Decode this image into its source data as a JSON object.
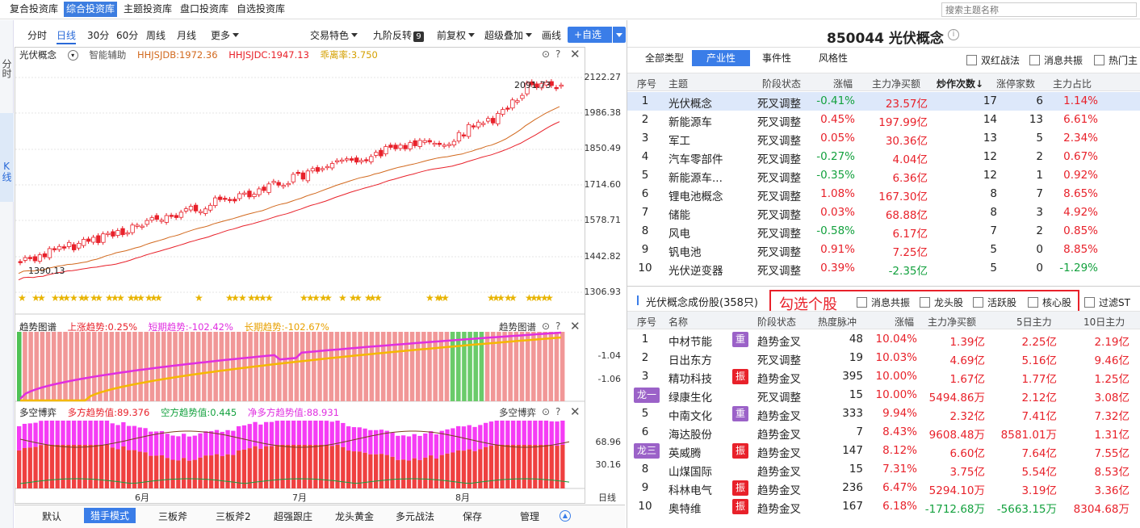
{
  "top_tabs": [
    "复合投资库",
    "综合投资库",
    "主题投资库",
    "盘口投资库",
    "自选投资库"
  ],
  "search_placeholder": "搜索主题名称",
  "side": {
    "fenshi": "分时",
    "kline": "K线"
  },
  "periods": [
    "分时",
    "日线",
    "30分",
    "60分",
    "周线",
    "月线",
    "更多"
  ],
  "tools": {
    "jiaoyi": "交易特色",
    "jiujie": "九阶反转",
    "jiujie_badge": "9",
    "fuquan": "前复权",
    "chaoji": "超级叠加",
    "huaxian": "画线",
    "add": "+自选"
  },
  "main_head": {
    "name": "光伏概念",
    "assist": "智能辅助",
    "hhjsjdb": "HHJSJDB:1972.36",
    "hhjsjdc": "HHJSJDC:1947.13",
    "pianli": "乖离率:3.750"
  },
  "price_axis": [
    "2122.27",
    "1986.38",
    "1850.49",
    "1714.60",
    "1578.71",
    "1442.82",
    "1306.93"
  ],
  "price_high": "2091.73",
  "price_low": "1390.13",
  "trend_head": {
    "title": "趋势图谱",
    "up": "上涨趋势:0.25%",
    "short": "短期趋势:-102.42%",
    "long": "长期趋势:-102.67%",
    "right": "趋势图谱"
  },
  "trend_axis": [
    "-1.04",
    "-1.06"
  ],
  "game_head": {
    "title": "多空博弈",
    "long": "多方趋势值:89.376",
    "short": "空方趋势值:0.445",
    "net": "净多方趋势值:88.931",
    "right": "多空博弈"
  },
  "game_axis": [
    "68.96",
    "30.16"
  ],
  "months": [
    "6月",
    "7月",
    "8月"
  ],
  "period_label": "日线",
  "bottom_tabs": [
    "默认",
    "猎手模式",
    "三板斧",
    "三板斧2",
    "超强跟庄",
    "龙头黄金",
    "多元战法",
    "保存",
    "管理"
  ],
  "code_title": "850044 光伏概念",
  "type_tabs": [
    "全部类型",
    "产业性",
    "事件性",
    "风格性"
  ],
  "top_checks": [
    "双红战法",
    "消息共振",
    "热门主"
  ],
  "theme_headers": [
    "序号",
    "主题",
    "阶段状态",
    "涨幅",
    "主力净买额",
    "炒作次数",
    "涨停家数",
    "主力占比"
  ],
  "themes": [
    {
      "no": "1",
      "name": "光伏概念",
      "stage": "死叉调整",
      "chg": "-0.41%",
      "net": "23.57亿",
      "times": "17",
      "limit": "6",
      "ratio": "1.14%"
    },
    {
      "no": "2",
      "name": "新能源车",
      "stage": "死叉调整",
      "chg": "0.45%",
      "net": "197.99亿",
      "times": "14",
      "limit": "13",
      "ratio": "6.61%"
    },
    {
      "no": "3",
      "name": "军工",
      "stage": "死叉调整",
      "chg": "0.05%",
      "net": "30.36亿",
      "times": "13",
      "limit": "5",
      "ratio": "2.34%"
    },
    {
      "no": "4",
      "name": "汽车零部件",
      "stage": "死叉调整",
      "chg": "-0.27%",
      "net": "4.04亿",
      "times": "12",
      "limit": "2",
      "ratio": "0.67%"
    },
    {
      "no": "5",
      "name": "新能源车...",
      "stage": "死叉调整",
      "chg": "-0.35%",
      "net": "6.36亿",
      "times": "12",
      "limit": "1",
      "ratio": "0.92%"
    },
    {
      "no": "6",
      "name": "锂电池概念",
      "stage": "死叉调整",
      "chg": "1.08%",
      "net": "167.30亿",
      "times": "8",
      "limit": "7",
      "ratio": "8.65%"
    },
    {
      "no": "7",
      "name": "储能",
      "stage": "死叉调整",
      "chg": "0.03%",
      "net": "68.88亿",
      "times": "8",
      "limit": "3",
      "ratio": "4.92%"
    },
    {
      "no": "8",
      "name": "风电",
      "stage": "死叉调整",
      "chg": "-0.58%",
      "net": "6.17亿",
      "times": "7",
      "limit": "2",
      "ratio": "0.85%"
    },
    {
      "no": "9",
      "name": "钒电池",
      "stage": "死叉调整",
      "chg": "0.91%",
      "net": "7.25亿",
      "times": "5",
      "limit": "0",
      "ratio": "8.85%"
    },
    {
      "no": "10",
      "name": "光伏逆变器",
      "stage": "死叉调整",
      "chg": "0.39%",
      "net": "-2.35亿",
      "times": "5",
      "limit": "0",
      "ratio": "-1.29%"
    }
  ],
  "comp_title": "光伏概念成份股(358只)",
  "gouxuan": "勾选个股",
  "comp_checks": [
    "消息共振",
    "龙头股",
    "活跃股",
    "核心股"
  ],
  "filter_st": "过滤ST",
  "stock_headers": [
    "序号",
    "名称",
    "阶段状态",
    "热度脉冲",
    "涨幅",
    "主力净买额",
    "5日主力",
    "10日主力"
  ],
  "stocks": [
    {
      "no": "1",
      "name": "中材节能",
      "tag": "重",
      "stage": "趋势金叉",
      "heat": "48",
      "chg": "10.04%",
      "net": "1.39亿",
      "d5": "2.25亿",
      "d10": "2.19亿"
    },
    {
      "no": "2",
      "name": "日出东方",
      "tag": "",
      "stage": "死叉调整",
      "heat": "19",
      "chg": "10.03%",
      "net": "4.69亿",
      "d5": "5.16亿",
      "d10": "9.46亿"
    },
    {
      "no": "3",
      "name": "精功科技",
      "tag": "振",
      "stage": "趋势金叉",
      "heat": "395",
      "chg": "10.00%",
      "net": "1.67亿",
      "d5": "1.77亿",
      "d10": "1.25亿"
    },
    {
      "no": "龙一",
      "name": "绿康生化",
      "tag": "",
      "stage": "死叉调整",
      "heat": "15",
      "chg": "10.00%",
      "net": "5494.86万",
      "d5": "2.12亿",
      "d10": "3.08亿"
    },
    {
      "no": "5",
      "name": "中南文化",
      "tag": "重",
      "stage": "趋势金叉",
      "heat": "333",
      "chg": "9.94%",
      "net": "2.32亿",
      "d5": "7.41亿",
      "d10": "7.32亿"
    },
    {
      "no": "6",
      "name": "海达股份",
      "tag": "",
      "stage": "趋势金叉",
      "heat": "7",
      "chg": "8.43%",
      "net": "9608.48万",
      "d5": "8581.01万",
      "d10": "1.31亿"
    },
    {
      "no": "龙三",
      "name": "英威腾",
      "tag": "振",
      "stage": "趋势金叉",
      "heat": "147",
      "chg": "8.12%",
      "net": "6.60亿",
      "d5": "7.64亿",
      "d10": "7.55亿"
    },
    {
      "no": "8",
      "name": "山煤国际",
      "tag": "",
      "stage": "趋势金叉",
      "heat": "15",
      "chg": "7.31%",
      "net": "3.75亿",
      "d5": "5.54亿",
      "d10": "8.53亿"
    },
    {
      "no": "9",
      "name": "科林电气",
      "tag": "振",
      "stage": "趋势金叉",
      "heat": "236",
      "chg": "6.47%",
      "net": "5294.10万",
      "d5": "3.19亿",
      "d10": "3.36亿"
    },
    {
      "no": "10",
      "name": "奥特维",
      "tag": "振",
      "stage": "趋势金叉",
      "heat": "167",
      "chg": "6.18%",
      "net": "-1712.68万",
      "d5": "-5663.15万",
      "d10": "8304.68万"
    }
  ]
}
